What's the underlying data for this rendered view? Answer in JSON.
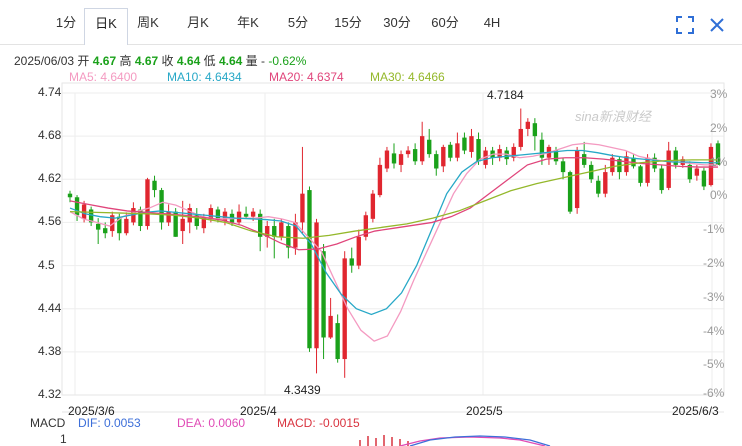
{
  "tabs": [
    {
      "label": "1分",
      "x": 51,
      "w": 30
    },
    {
      "label": "日K",
      "x": 84,
      "w": 42,
      "active": true
    },
    {
      "label": "周K",
      "x": 133,
      "w": 30
    },
    {
      "label": "月K",
      "x": 183,
      "w": 30
    },
    {
      "label": "年K",
      "x": 233,
      "w": 30
    },
    {
      "label": "5分",
      "x": 283,
      "w": 30
    },
    {
      "label": "15分",
      "x": 330,
      "w": 36
    },
    {
      "label": "30分",
      "x": 379,
      "w": 36
    },
    {
      "label": "60分",
      "x": 427,
      "w": 36
    },
    {
      "label": "4H",
      "x": 477,
      "w": 30
    }
  ],
  "info": {
    "date": "2025/06/03",
    "open_label": "开",
    "open": "4.67",
    "high_label": "高",
    "high": "4.67",
    "close_label": "收",
    "close": "4.64",
    "low_label": "低",
    "low": "4.64",
    "vol_label": "量",
    "vol": "-",
    "change": "-0.62%"
  },
  "ma": [
    {
      "label": "MA5: 4.6400",
      "color": "#f49ac1"
    },
    {
      "label": "MA10: 4.6434",
      "color": "#27a8c7"
    },
    {
      "label": "MA20: 4.6374",
      "color": "#e0457b"
    },
    {
      "label": "MA30: 4.6466",
      "color": "#94b82b"
    }
  ],
  "macd": {
    "macd_label": "MACD",
    "dif": "DIF: 0.0053",
    "dif_color": "#3d6fd9",
    "dea": "DEA: 0.0060",
    "dea_color": "#e04bb6",
    "macd": "MACD: -0.0015",
    "macd_color": "#d9333f",
    "axis_top": "1"
  },
  "watermark": "sina新浪财经",
  "chart_data": {
    "type": "candlestick",
    "ylim": [
      4.32,
      4.74
    ],
    "yticks": [
      "4.74",
      "4.68",
      "4.62",
      "4.56",
      "4.5",
      "4.44",
      "4.38",
      "4.32"
    ],
    "pct_ticks": [
      "3%",
      "2%",
      "1%",
      "0%",
      "-1%",
      "-2%",
      "-3%",
      "-4%",
      "-5%",
      "-6%"
    ],
    "x_labels": [
      "2025/3/6",
      "2025/4",
      "2025/5",
      "2025/6/3"
    ],
    "annotations": {
      "high": "4.7184",
      "low": "4.3439"
    },
    "up_color": "#e0262f",
    "down_color": "#1aa11a",
    "candles": [
      [
        4.6,
        4.595,
        4.604,
        4.588
      ],
      [
        4.595,
        4.57,
        4.598,
        4.562
      ],
      [
        4.565,
        4.585,
        4.59,
        4.56
      ],
      [
        4.578,
        4.56,
        4.582,
        4.555
      ],
      [
        4.558,
        4.55,
        4.566,
        4.53
      ],
      [
        4.552,
        4.545,
        4.56,
        4.538
      ],
      [
        4.548,
        4.57,
        4.575,
        4.54
      ],
      [
        4.568,
        4.545,
        4.572,
        4.535
      ],
      [
        4.545,
        4.565,
        4.574,
        4.542
      ],
      [
        4.56,
        4.58,
        4.588,
        4.556
      ],
      [
        4.578,
        4.555,
        4.582,
        4.548
      ],
      [
        4.555,
        4.62,
        4.622,
        4.55
      ],
      [
        4.618,
        4.605,
        4.625,
        4.595
      ],
      [
        4.605,
        4.56,
        4.608,
        4.55
      ],
      [
        4.56,
        4.575,
        4.585,
        4.555
      ],
      [
        4.575,
        4.54,
        4.58,
        4.54
      ],
      [
        4.548,
        4.565,
        4.59,
        4.53
      ],
      [
        4.56,
        4.58,
        4.586,
        4.545
      ],
      [
        4.57,
        4.555,
        4.58,
        4.55
      ],
      [
        4.552,
        4.568,
        4.572,
        4.545
      ],
      [
        4.565,
        4.58,
        4.585,
        4.56
      ],
      [
        4.578,
        4.565,
        4.582,
        4.56
      ],
      [
        4.562,
        4.575,
        4.58,
        4.556
      ],
      [
        4.572,
        4.56,
        4.578,
        4.555
      ],
      [
        4.56,
        4.575,
        4.585,
        4.556
      ],
      [
        4.572,
        4.568,
        4.582,
        4.565
      ],
      [
        4.568,
        4.575,
        4.58,
        4.562
      ],
      [
        4.572,
        4.54,
        4.578,
        4.52
      ],
      [
        4.54,
        4.555,
        4.562,
        4.525
      ],
      [
        4.555,
        4.54,
        4.565,
        4.51
      ],
      [
        4.54,
        4.56,
        4.565,
        4.535
      ],
      [
        4.555,
        4.525,
        4.56,
        4.51
      ],
      [
        4.525,
        4.56,
        4.572,
        4.515
      ],
      [
        4.56,
        4.6,
        4.665,
        4.545
      ],
      [
        4.605,
        4.385,
        4.61,
        4.38
      ],
      [
        4.385,
        4.56,
        4.565,
        4.35
      ],
      [
        4.52,
        4.4,
        4.53,
        4.37
      ],
      [
        4.4,
        4.43,
        4.455,
        4.398
      ],
      [
        4.42,
        4.37,
        4.432,
        4.365
      ],
      [
        4.37,
        4.51,
        4.52,
        4.3439
      ],
      [
        4.51,
        4.5,
        4.525,
        4.49
      ],
      [
        4.5,
        4.54,
        4.55,
        4.495
      ],
      [
        4.54,
        4.57,
        4.575,
        4.535
      ],
      [
        4.565,
        4.6,
        4.605,
        4.56
      ],
      [
        4.598,
        4.64,
        4.65,
        4.595
      ],
      [
        4.635,
        4.66,
        4.665,
        4.63
      ],
      [
        4.656,
        4.642,
        4.67,
        4.635
      ],
      [
        4.64,
        4.655,
        4.66,
        4.63
      ],
      [
        4.655,
        4.66,
        4.666,
        4.65
      ],
      [
        4.662,
        4.645,
        4.67,
        4.64
      ],
      [
        4.645,
        4.68,
        4.7,
        4.64
      ],
      [
        4.675,
        4.655,
        4.69,
        4.65
      ],
      [
        4.655,
        4.635,
        4.66,
        4.625
      ],
      [
        4.638,
        4.665,
        4.668,
        4.63
      ],
      [
        4.668,
        4.65,
        4.672,
        4.645
      ],
      [
        4.65,
        4.67,
        4.685,
        4.645
      ],
      [
        4.678,
        4.66,
        4.685,
        4.655
      ],
      [
        4.658,
        4.68,
        4.69,
        4.65
      ],
      [
        4.676,
        4.645,
        4.685,
        4.64
      ],
      [
        4.64,
        4.66,
        4.665,
        4.635
      ],
      [
        4.66,
        4.65,
        4.665,
        4.64
      ],
      [
        4.65,
        4.662,
        4.668,
        4.645
      ],
      [
        4.66,
        4.648,
        4.665,
        4.64
      ],
      [
        4.65,
        4.665,
        4.67,
        4.645
      ],
      [
        4.665,
        4.69,
        4.7184,
        4.66
      ],
      [
        4.69,
        4.7,
        4.705,
        4.68
      ],
      [
        4.698,
        4.68,
        4.705,
        4.66
      ],
      [
        4.675,
        4.65,
        4.685,
        4.64
      ],
      [
        4.65,
        4.665,
        4.668,
        4.64
      ],
      [
        4.66,
        4.645,
        4.665,
        4.64
      ],
      [
        4.645,
        4.63,
        4.65,
        4.62
      ],
      [
        4.63,
        4.575,
        4.632,
        4.572
      ],
      [
        4.58,
        4.66,
        4.665,
        4.572
      ],
      [
        4.655,
        4.64,
        4.672,
        4.636
      ],
      [
        4.64,
        4.62,
        4.645,
        4.615
      ],
      [
        4.618,
        4.6,
        4.625,
        4.595
      ],
      [
        4.6,
        4.63,
        4.64,
        4.595
      ],
      [
        4.63,
        4.65,
        4.655,
        4.625
      ],
      [
        4.648,
        4.63,
        4.652,
        4.62
      ],
      [
        4.63,
        4.652,
        4.66,
        4.625
      ],
      [
        4.65,
        4.638,
        4.655,
        4.635
      ],
      [
        4.638,
        4.615,
        4.64,
        4.61
      ],
      [
        4.615,
        4.65,
        4.655,
        4.61
      ],
      [
        4.65,
        4.635,
        4.656,
        4.63
      ],
      [
        4.635,
        4.605,
        4.64,
        4.6
      ],
      [
        4.608,
        4.66,
        4.672,
        4.605
      ],
      [
        4.66,
        4.64,
        4.665,
        4.635
      ],
      [
        4.64,
        4.648,
        4.652,
        4.636
      ],
      [
        4.64,
        4.62,
        4.645,
        4.615
      ],
      [
        4.625,
        4.635,
        4.64,
        4.618
      ],
      [
        4.632,
        4.61,
        4.636,
        4.605
      ],
      [
        4.612,
        4.665,
        4.67,
        4.61
      ],
      [
        4.67,
        4.64,
        4.674,
        4.64
      ]
    ],
    "ma_series": {
      "MA5": [
        4.575,
        4.565,
        4.56,
        4.555,
        4.568,
        4.575,
        4.58,
        4.588,
        4.584,
        4.576,
        4.568,
        4.565,
        4.565,
        4.566,
        4.566,
        4.568,
        4.565,
        4.56,
        4.54,
        4.52,
        4.48,
        4.44,
        4.41,
        4.395,
        4.402,
        4.436,
        4.48,
        4.52,
        4.56,
        4.6,
        4.628,
        4.648,
        4.655,
        4.655,
        4.65,
        4.652,
        4.656,
        4.662,
        4.668,
        4.67,
        4.668,
        4.664,
        4.66,
        4.652,
        4.648,
        4.645,
        4.644,
        4.642,
        4.64,
        4.64
      ],
      "MA10": [
        4.58,
        4.572,
        4.568,
        4.566,
        4.57,
        4.574,
        4.576,
        4.574,
        4.572,
        4.57,
        4.568,
        4.566,
        4.565,
        4.564,
        4.562,
        4.555,
        4.53,
        4.49,
        4.46,
        4.44,
        4.432,
        4.44,
        4.462,
        4.5,
        4.55,
        4.6,
        4.63,
        4.645,
        4.65,
        4.652,
        4.654,
        4.656,
        4.658,
        4.66,
        4.66,
        4.657,
        4.653,
        4.65,
        4.648,
        4.646,
        4.644,
        4.644,
        4.643,
        4.643
      ],
      "MA20": [
        4.59,
        4.585,
        4.58,
        4.576,
        4.574,
        4.572,
        4.57,
        4.567,
        4.563,
        4.556,
        4.545,
        4.532,
        4.522,
        4.523,
        4.53,
        4.54,
        4.548,
        4.552,
        4.556,
        4.56,
        4.568,
        4.58,
        4.6,
        4.62,
        4.64,
        4.648,
        4.65,
        4.65,
        4.648,
        4.645,
        4.642,
        4.64,
        4.638,
        4.637,
        4.637
      ],
      "MA30": [
        4.575,
        4.574,
        4.573,
        4.572,
        4.57,
        4.566,
        4.56,
        4.548,
        4.54,
        4.538,
        4.542,
        4.548,
        4.553,
        4.558,
        4.566,
        4.576,
        4.59,
        4.604,
        4.614,
        4.622,
        4.63,
        4.638,
        4.643,
        4.646,
        4.647,
        4.647
      ]
    }
  }
}
